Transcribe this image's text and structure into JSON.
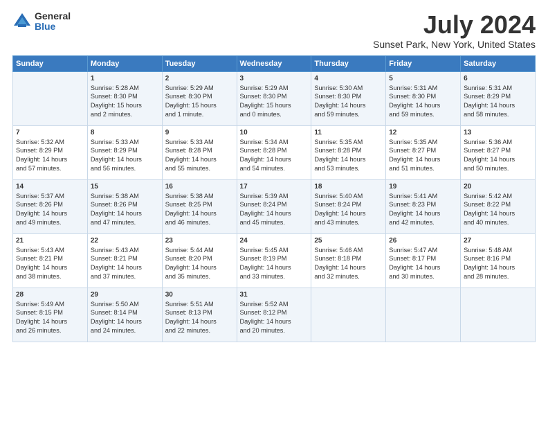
{
  "logo": {
    "general": "General",
    "blue": "Blue"
  },
  "header": {
    "month": "July 2024",
    "location": "Sunset Park, New York, United States"
  },
  "weekdays": [
    "Sunday",
    "Monday",
    "Tuesday",
    "Wednesday",
    "Thursday",
    "Friday",
    "Saturday"
  ],
  "weeks": [
    [
      {
        "day": "",
        "info": ""
      },
      {
        "day": "1",
        "info": "Sunrise: 5:28 AM\nSunset: 8:30 PM\nDaylight: 15 hours\nand 2 minutes."
      },
      {
        "day": "2",
        "info": "Sunrise: 5:29 AM\nSunset: 8:30 PM\nDaylight: 15 hours\nand 1 minute."
      },
      {
        "day": "3",
        "info": "Sunrise: 5:29 AM\nSunset: 8:30 PM\nDaylight: 15 hours\nand 0 minutes."
      },
      {
        "day": "4",
        "info": "Sunrise: 5:30 AM\nSunset: 8:30 PM\nDaylight: 14 hours\nand 59 minutes."
      },
      {
        "day": "5",
        "info": "Sunrise: 5:31 AM\nSunset: 8:30 PM\nDaylight: 14 hours\nand 59 minutes."
      },
      {
        "day": "6",
        "info": "Sunrise: 5:31 AM\nSunset: 8:29 PM\nDaylight: 14 hours\nand 58 minutes."
      }
    ],
    [
      {
        "day": "7",
        "info": "Sunrise: 5:32 AM\nSunset: 8:29 PM\nDaylight: 14 hours\nand 57 minutes."
      },
      {
        "day": "8",
        "info": "Sunrise: 5:33 AM\nSunset: 8:29 PM\nDaylight: 14 hours\nand 56 minutes."
      },
      {
        "day": "9",
        "info": "Sunrise: 5:33 AM\nSunset: 8:28 PM\nDaylight: 14 hours\nand 55 minutes."
      },
      {
        "day": "10",
        "info": "Sunrise: 5:34 AM\nSunset: 8:28 PM\nDaylight: 14 hours\nand 54 minutes."
      },
      {
        "day": "11",
        "info": "Sunrise: 5:35 AM\nSunset: 8:28 PM\nDaylight: 14 hours\nand 53 minutes."
      },
      {
        "day": "12",
        "info": "Sunrise: 5:35 AM\nSunset: 8:27 PM\nDaylight: 14 hours\nand 51 minutes."
      },
      {
        "day": "13",
        "info": "Sunrise: 5:36 AM\nSunset: 8:27 PM\nDaylight: 14 hours\nand 50 minutes."
      }
    ],
    [
      {
        "day": "14",
        "info": "Sunrise: 5:37 AM\nSunset: 8:26 PM\nDaylight: 14 hours\nand 49 minutes."
      },
      {
        "day": "15",
        "info": "Sunrise: 5:38 AM\nSunset: 8:26 PM\nDaylight: 14 hours\nand 47 minutes."
      },
      {
        "day": "16",
        "info": "Sunrise: 5:38 AM\nSunset: 8:25 PM\nDaylight: 14 hours\nand 46 minutes."
      },
      {
        "day": "17",
        "info": "Sunrise: 5:39 AM\nSunset: 8:24 PM\nDaylight: 14 hours\nand 45 minutes."
      },
      {
        "day": "18",
        "info": "Sunrise: 5:40 AM\nSunset: 8:24 PM\nDaylight: 14 hours\nand 43 minutes."
      },
      {
        "day": "19",
        "info": "Sunrise: 5:41 AM\nSunset: 8:23 PM\nDaylight: 14 hours\nand 42 minutes."
      },
      {
        "day": "20",
        "info": "Sunrise: 5:42 AM\nSunset: 8:22 PM\nDaylight: 14 hours\nand 40 minutes."
      }
    ],
    [
      {
        "day": "21",
        "info": "Sunrise: 5:43 AM\nSunset: 8:21 PM\nDaylight: 14 hours\nand 38 minutes."
      },
      {
        "day": "22",
        "info": "Sunrise: 5:43 AM\nSunset: 8:21 PM\nDaylight: 14 hours\nand 37 minutes."
      },
      {
        "day": "23",
        "info": "Sunrise: 5:44 AM\nSunset: 8:20 PM\nDaylight: 14 hours\nand 35 minutes."
      },
      {
        "day": "24",
        "info": "Sunrise: 5:45 AM\nSunset: 8:19 PM\nDaylight: 14 hours\nand 33 minutes."
      },
      {
        "day": "25",
        "info": "Sunrise: 5:46 AM\nSunset: 8:18 PM\nDaylight: 14 hours\nand 32 minutes."
      },
      {
        "day": "26",
        "info": "Sunrise: 5:47 AM\nSunset: 8:17 PM\nDaylight: 14 hours\nand 30 minutes."
      },
      {
        "day": "27",
        "info": "Sunrise: 5:48 AM\nSunset: 8:16 PM\nDaylight: 14 hours\nand 28 minutes."
      }
    ],
    [
      {
        "day": "28",
        "info": "Sunrise: 5:49 AM\nSunset: 8:15 PM\nDaylight: 14 hours\nand 26 minutes."
      },
      {
        "day": "29",
        "info": "Sunrise: 5:50 AM\nSunset: 8:14 PM\nDaylight: 14 hours\nand 24 minutes."
      },
      {
        "day": "30",
        "info": "Sunrise: 5:51 AM\nSunset: 8:13 PM\nDaylight: 14 hours\nand 22 minutes."
      },
      {
        "day": "31",
        "info": "Sunrise: 5:52 AM\nSunset: 8:12 PM\nDaylight: 14 hours\nand 20 minutes."
      },
      {
        "day": "",
        "info": ""
      },
      {
        "day": "",
        "info": ""
      },
      {
        "day": "",
        "info": ""
      }
    ]
  ]
}
